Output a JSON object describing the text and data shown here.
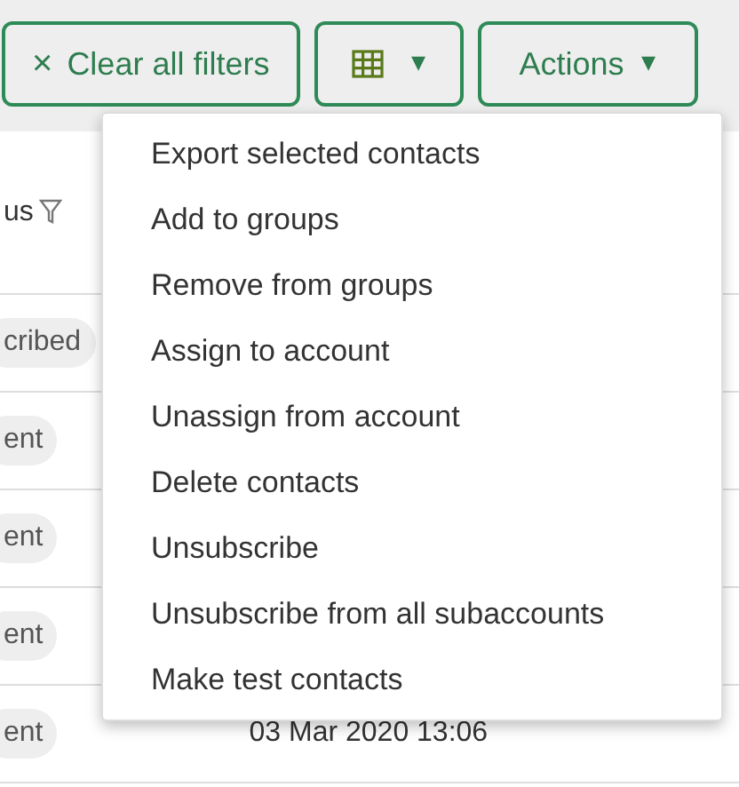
{
  "toolbar": {
    "clear_filters": {
      "icon": "×",
      "label": "Clear all filters"
    },
    "columns_button": {
      "caret": "▾"
    },
    "actions_button": {
      "label": "Actions",
      "caret": "▾",
      "expanded": true
    }
  },
  "table": {
    "columns": [
      {
        "label": "us",
        "filter": true
      }
    ],
    "rows": [
      {
        "status": "cribed",
        "date": ""
      },
      {
        "status": "ent",
        "date": ""
      },
      {
        "status": "ent",
        "date": ""
      },
      {
        "status": "ent",
        "date": ""
      },
      {
        "status": "ent",
        "date": "03 Mar 2020 13:06"
      }
    ]
  },
  "actions_menu": {
    "items": [
      {
        "label": "Export selected contacts"
      },
      {
        "label": "Add to groups"
      },
      {
        "label": "Remove from groups"
      },
      {
        "label": "Assign to account"
      },
      {
        "label": "Unassign from account"
      },
      {
        "label": "Delete contacts"
      },
      {
        "label": "Unsubscribe"
      },
      {
        "label": "Unsubscribe from all subaccounts"
      },
      {
        "label": "Make test contacts"
      }
    ]
  }
}
